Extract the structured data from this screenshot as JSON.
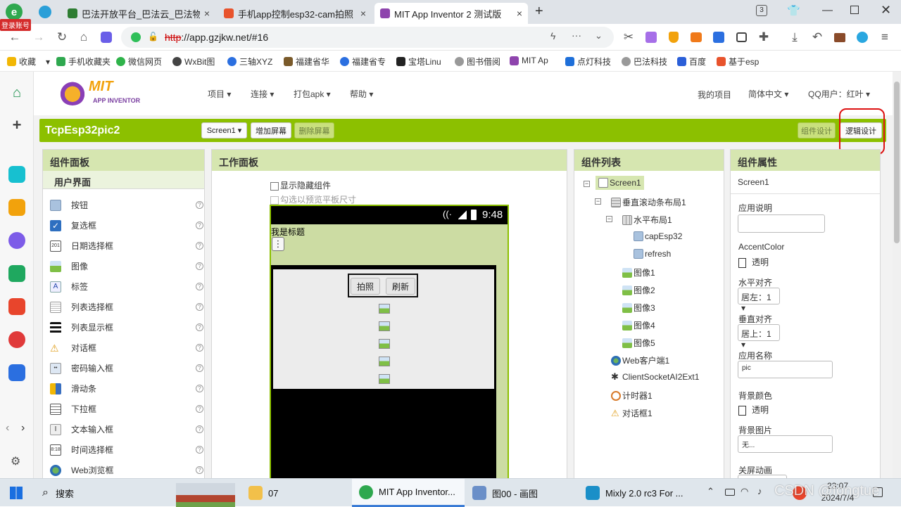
{
  "tabs": [
    {
      "label": "巴法开放平台_巴法云_巴法物联",
      "color": "#2e7d32"
    },
    {
      "label": "手机app控制esp32-cam拍照",
      "color": "#e8532c"
    },
    {
      "label": "MIT App Inventor 2 测试版",
      "color": "#8e44ad"
    }
  ],
  "browser": {
    "login_badge": "登录账号",
    "tab_count": "3",
    "new_tab": "+",
    "url_scheme": "http",
    "url_rest": "://app.gzjkw.net/#16"
  },
  "bookmarks": [
    "收藏",
    "手机收藏夹",
    "微信网页",
    "WxBit图",
    "三轴XYZ",
    "福建省华",
    "福建省专",
    "宝塔Linu",
    "图书借阅",
    "MIT Ap",
    "点灯科技",
    "巴法科技",
    "百度",
    "基于esp"
  ],
  "app": {
    "logo_top": "MIT",
    "logo_bottom": "APP INVENTOR",
    "menu": [
      "项目 ▾",
      "连接 ▾",
      "打包apk ▾",
      "帮助 ▾"
    ],
    "right_menu": [
      "我的项目",
      "简体中文 ▾",
      "QQ用户：红叶 ▾"
    ],
    "project_name": "TcpEsp32pic2",
    "screen_select": "Screen1 ▾",
    "add_screen": "增加屏幕",
    "remove_screen": "删除屏幕",
    "designer_btn": "组件设计",
    "blocks_btn": "逻辑设计"
  },
  "palette": {
    "title": "组件面板",
    "category": "用户界面",
    "items": [
      "按钮",
      "复选框",
      "日期选择框",
      "图像",
      "标签",
      "列表选择框",
      "列表显示框",
      "对话框",
      "密码输入框",
      "滑动条",
      "下拉框",
      "文本输入框",
      "时间选择框",
      "Web浏览框"
    ],
    "help": "?"
  },
  "viewer": {
    "title": "工作面板",
    "show_hidden": "显示隐藏组件",
    "tablet_preview": "勾选以预览平板尺寸",
    "time": "9:48",
    "screen_title": "我是标题",
    "overflow": "⋮",
    "btn1": "拍照",
    "btn2": "刷新"
  },
  "components": {
    "title": "组件列表",
    "tree": [
      "Screen1",
      "垂直滚动条布局1",
      "水平布局1",
      "capEsp32",
      "refresh",
      "图像1",
      "图像2",
      "图像3",
      "图像4",
      "图像5",
      "Web客户端1",
      "ClientSocketAI2Ext1",
      "计时器1",
      "对话框1"
    ]
  },
  "properties": {
    "title": "组件属性",
    "component": "Screen1",
    "app_desc_label": "应用说明",
    "accent_label": "AccentColor",
    "accent_value": "透明",
    "halign_label": "水平对齐",
    "halign_value": "居左：1 ▾",
    "valign_label": "垂直对齐",
    "valign_value": "居上：1 ▾",
    "appname_label": "应用名称",
    "appname_value": "pic",
    "bgcolor_label": "背景颜色",
    "bgcolor_value": "透明",
    "bgimage_label": "背景图片",
    "bgimage_value": "无...",
    "close_anim_label": "关屏动画"
  },
  "taskbar": {
    "search": "搜索",
    "items": [
      "07",
      "MIT App Inventor...",
      "图00 - 画图",
      "Mixly 2.0 rc3 For ..."
    ],
    "time": "23:07",
    "date": "2024/7/4",
    "watermark": "CSDN @fongtue"
  }
}
